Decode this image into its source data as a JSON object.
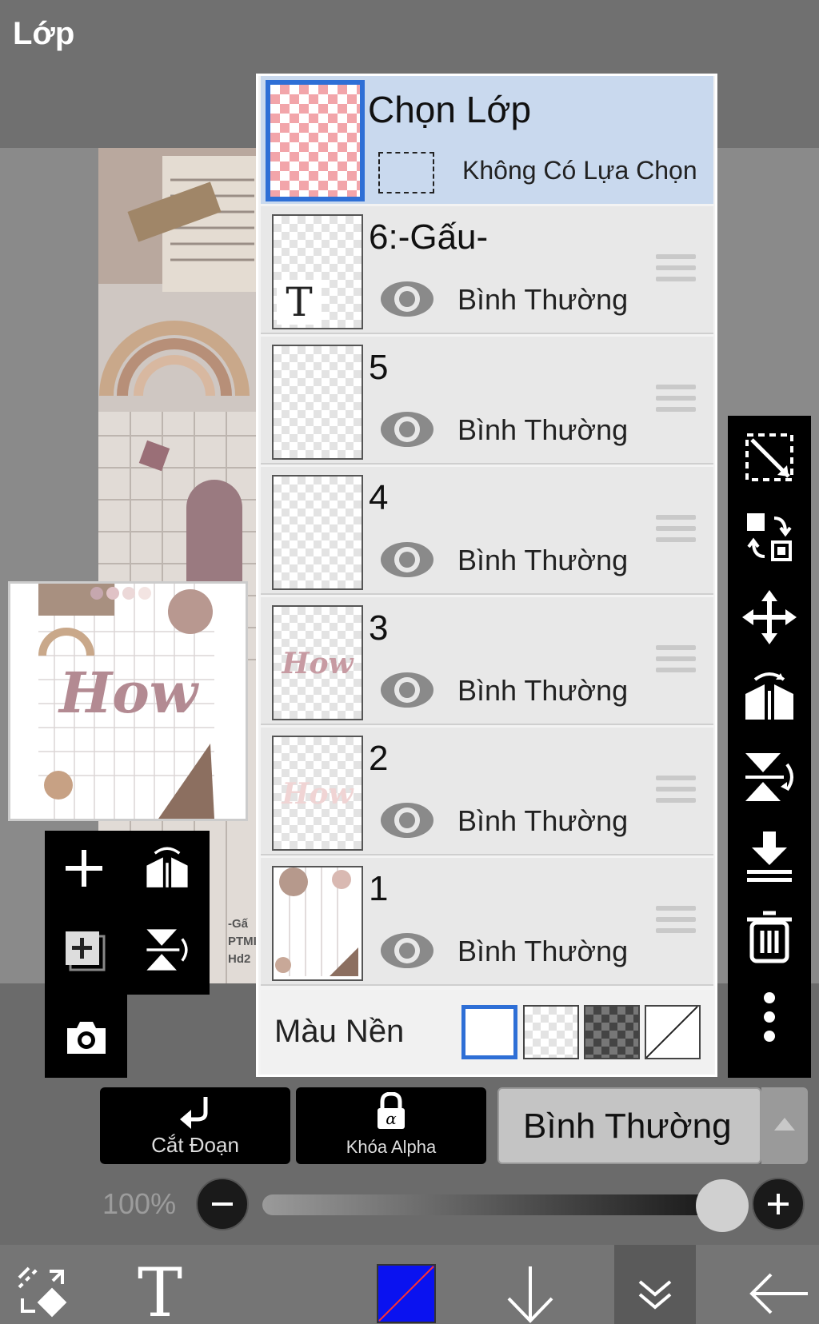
{
  "header": {
    "title": "Lớp"
  },
  "select_layer": {
    "title": "Chọn Lớp",
    "status": "Không Có Lựa Chọn"
  },
  "layers": [
    {
      "name": "6:-Gấu-",
      "mode": "Bình Thường",
      "thumb": "text"
    },
    {
      "name": "5",
      "mode": "Bình Thường",
      "thumb": "empty"
    },
    {
      "name": "4",
      "mode": "Bình Thường",
      "thumb": "empty"
    },
    {
      "name": "3",
      "mode": "Bình Thường",
      "thumb": "how"
    },
    {
      "name": "2",
      "mode": "Bình Thường",
      "thumb": "how-light"
    },
    {
      "name": "1",
      "mode": "Bình Thường",
      "thumb": "image"
    }
  ],
  "background": {
    "label": "Màu Nền",
    "swatches": [
      "white",
      "transparent",
      "dark-checker",
      "none"
    ],
    "selected": "white"
  },
  "preview": {
    "text": "How"
  },
  "canvas_text": {
    "line1": "-Gấ",
    "line2": "PTMI",
    "line3": "Hd2"
  },
  "controls": {
    "clipping_label": "Cắt Đoạn",
    "alpha_lock_label": "Khóa Alpha",
    "blend_mode": "Bình Thường",
    "opacity": "100%",
    "opacity_value": 100
  },
  "right_toolbar": [
    "select-transform-icon",
    "transfer-icon",
    "move-icon",
    "flip-horizontal-icon",
    "flip-vertical-icon",
    "merge-down-icon",
    "trash-icon",
    "more-icon"
  ],
  "left_toolbar": [
    "add-layer-icon",
    "flip-h-icon",
    "add-copy-icon",
    "flip-v-icon",
    "camera-icon"
  ],
  "bottom_nav": [
    "transform-tool-icon",
    "text-tool-icon",
    "color-swatch",
    "down-arrow-icon",
    "double-chevron-icon",
    "back-arrow-icon"
  ],
  "colors": {
    "accent": "#2e6fd6",
    "selected_row": "#c9d9ee",
    "current_color": "#0a12f0"
  }
}
